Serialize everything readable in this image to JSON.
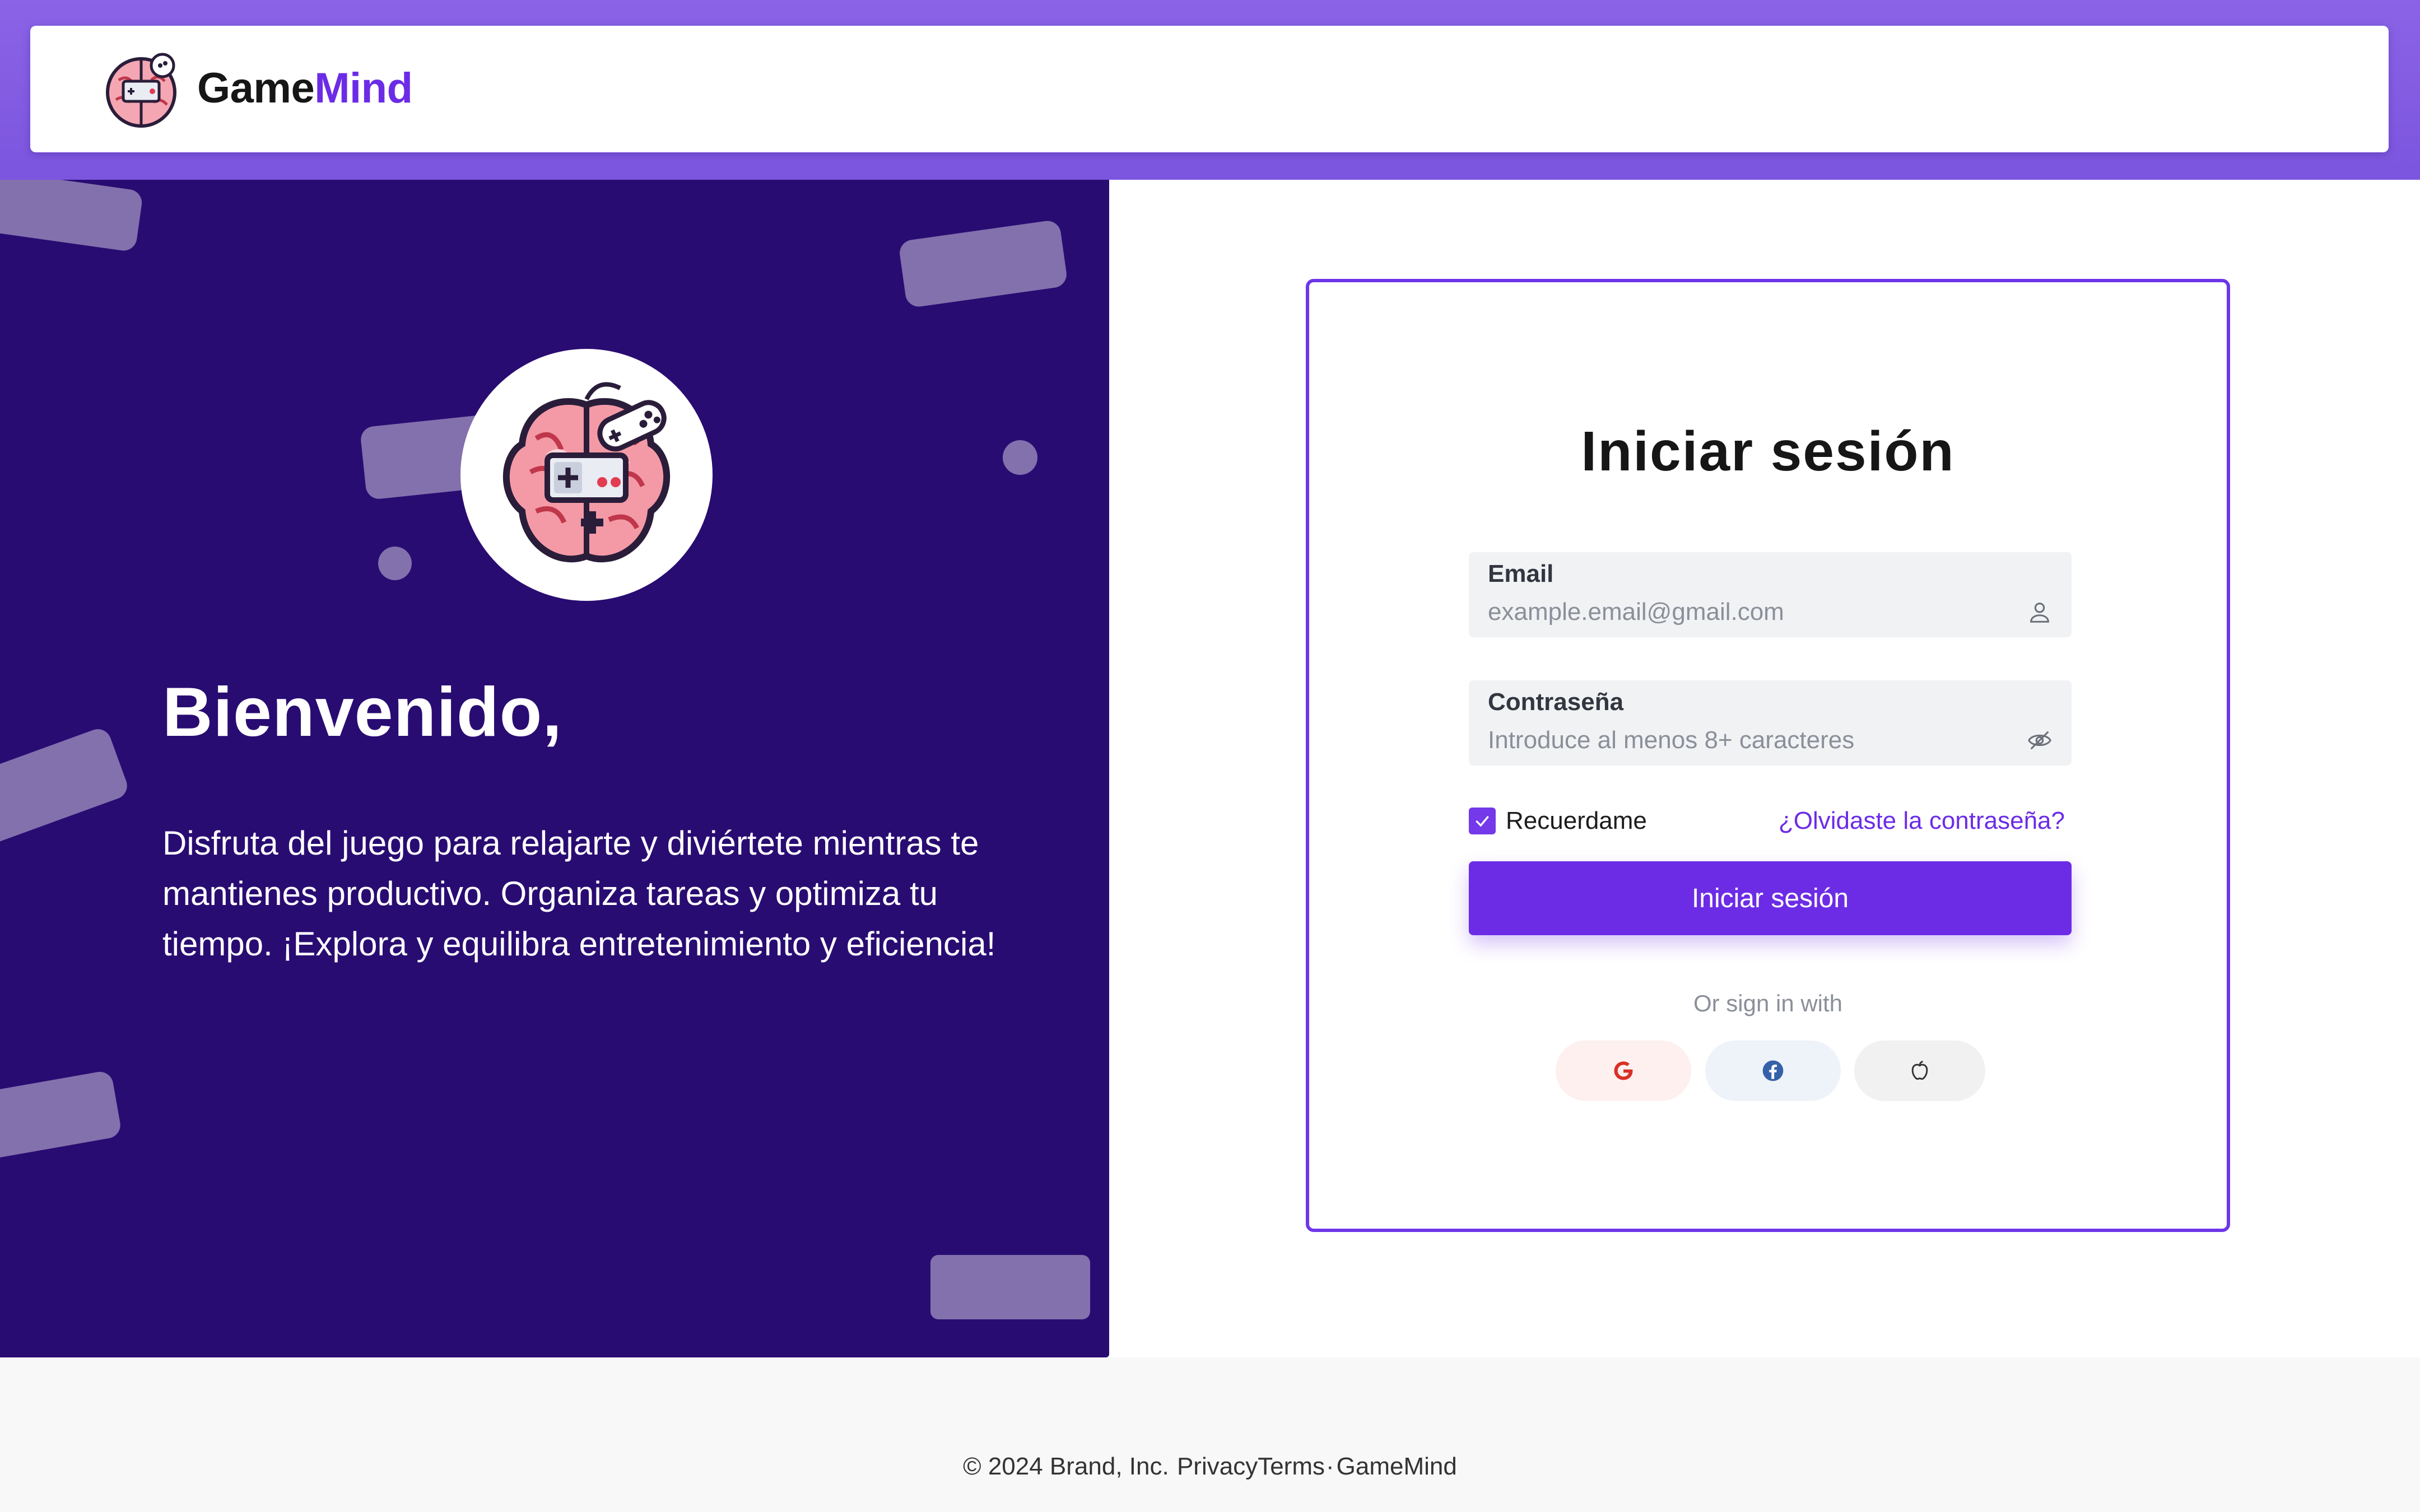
{
  "header": {
    "brand_primary": "Game",
    "brand_accent": "Mind",
    "logo_icon": "brain-gamepad-icon"
  },
  "hero": {
    "title": "Bienvenido,",
    "description": "Disfruta del juego para relajarte y diviértete mientras te mantienes productivo. Organiza tareas y optimiza tu tiempo. ¡Explora y equilibra entretenimiento y eficiencia!"
  },
  "login": {
    "title": "Iniciar sesión",
    "email": {
      "label": "Email",
      "placeholder": "example.email@gmail.com",
      "value": "",
      "icon": "user-icon"
    },
    "password": {
      "label": "Contraseña",
      "placeholder": "Introduce al menos 8+ caracteres",
      "value": "",
      "icon": "eye-off-icon"
    },
    "remember_label": "Recuerdame",
    "remember_checked": true,
    "forgot_label": "¿Olvidaste la contraseña?",
    "submit_label": "Iniciar sesión",
    "or_text": "Or sign in with",
    "social": [
      {
        "name": "google-icon"
      },
      {
        "name": "facebook-icon"
      },
      {
        "name": "apple-icon"
      }
    ]
  },
  "footer": {
    "copyright": "© 2024 Brand, Inc.",
    "privacy": "Privacy",
    "terms": "Terms",
    "separator": "·",
    "brand": "GameMind"
  },
  "colors": {
    "header_band": "#8a63e6",
    "hero_background": "#290c72",
    "accent": "#6c2ce6",
    "field_background": "#f1f2f4",
    "footer_background": "#f8f8f8"
  }
}
